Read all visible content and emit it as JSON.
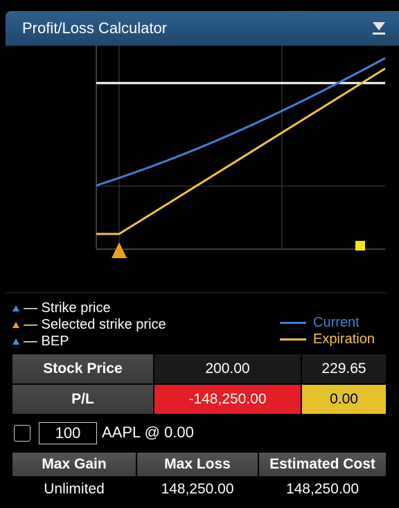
{
  "window": {
    "title": "Profit/Loss Calculator"
  },
  "legend": {
    "strike": "— Strike price",
    "selected_strike": "— Selected strike price",
    "bep": "— BEP",
    "current": "Current",
    "expiration": "Expiration"
  },
  "colors": {
    "current": "#3f7fd6",
    "expiration": "#f3c43a",
    "negative": "#e41e26",
    "highlight": "#e5c22c",
    "strike_marker": "#eaa21e",
    "bep_marker": "#f5e51e"
  },
  "table": {
    "stock_price_label": "Stock Price",
    "stock_price_value": "200.00",
    "stock_price_breakeven": "229.65",
    "pl_label": "P/L",
    "pl_value": "-148,250.00",
    "pl_breakeven": "0.00"
  },
  "position": {
    "quantity": "100",
    "description": "AAPL @ 0.00"
  },
  "summary": {
    "max_gain_label": "Max Gain",
    "max_loss_label": "Max Loss",
    "estimated_cost_label": "Estimated Cost",
    "max_gain_value": "Unlimited",
    "max_loss_value": "148,250.00",
    "estimated_cost_value": "148,250.00"
  }
}
